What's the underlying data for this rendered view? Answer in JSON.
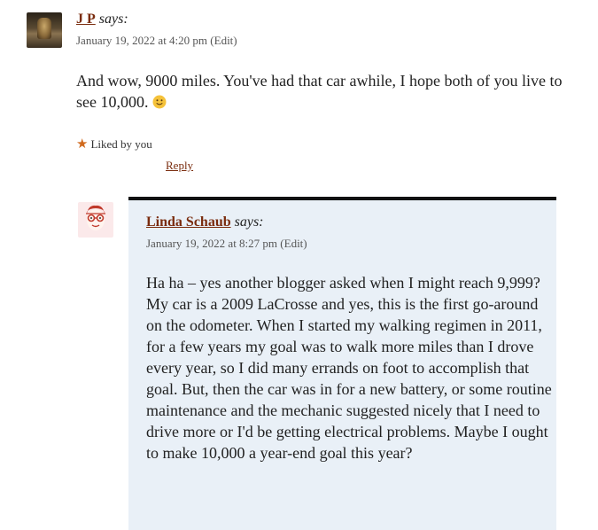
{
  "comment1": {
    "author": "J P",
    "says": "says:",
    "date": "January 19, 2022 at 4:20 pm",
    "edit": "(Edit)",
    "text": "And wow, 9000 miles. You've had that car awhile, I hope both of you live to see 10,000.",
    "emoji": "slightly-smiling-face-icon",
    "liked": "Liked by you",
    "reply": "Reply"
  },
  "comment2": {
    "author": "Linda Schaub",
    "says": "says:",
    "date": "January 19, 2022 at 8:27 pm",
    "edit": "(Edit)",
    "text": "Ha ha – yes another blogger asked when I might reach 9,999? My car is a 2009 LaCrosse and yes, this is the first go-around on the odometer. When I started my walking regimen in 2011, for a few years my goal was to walk more miles than I drove every year, so I did many errands on foot to accomplish that goal. But, then the car was in for a new battery, or some routine maintenance and the mechanic suggested nicely that I need to drive more or I'd be getting electrical problems. Maybe I ought to make 10,000 a year-end goal this year?"
  },
  "colors": {
    "link": "#7a2c0e",
    "reply_bg": "#e9f0f7",
    "star": "#d06a1e"
  }
}
